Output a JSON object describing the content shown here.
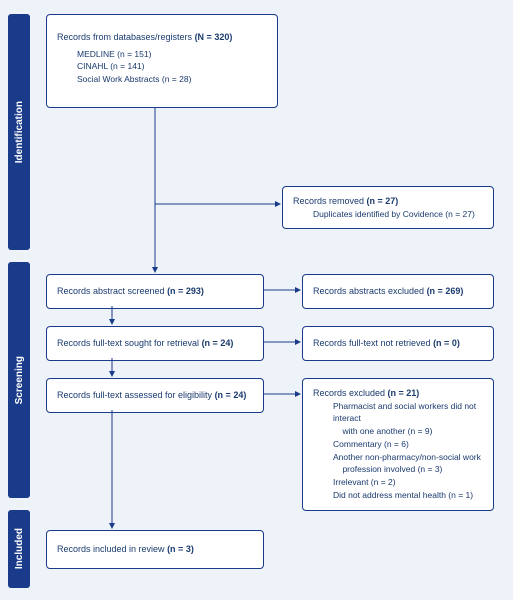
{
  "stages": {
    "identification": "Identification",
    "screening": "Screening",
    "included": "Included"
  },
  "boxes": {
    "sources": {
      "title_pre": "Records from databases/registers ",
      "title_n": "(N = 320)",
      "items": [
        "MEDLINE (n = 151)",
        "CINAHL (n = 141)",
        "Social Work Abstracts (n = 28)"
      ]
    },
    "removed": {
      "title_pre": "Records removed ",
      "title_n": "(n = 27)",
      "items": [
        "Duplicates identified by Covidence (n = 27)"
      ]
    },
    "abs_screened": {
      "text_pre": "Records abstract screened ",
      "n": "(n = 293)"
    },
    "abs_excluded": {
      "text_pre": "Records abstracts excluded ",
      "n": "(n = 269)"
    },
    "ft_sought": {
      "text_pre": "Records full-text sought for retrieval ",
      "n": "(n = 24)"
    },
    "ft_notret": {
      "text_pre": "Records full-text not retrieved ",
      "n": "(n = 0)"
    },
    "ft_assessed": {
      "text_pre": "Records full-text assessed for eligibility ",
      "n": "(n = 24)"
    },
    "excluded": {
      "title_pre": "Records excluded ",
      "title_n": "(n = 21)",
      "items": [
        "Pharmacist and social workers did not interact",
        "    with one another (n = 9)",
        "Commentary (n = 6)",
        "Another non-pharmacy/non-social work",
        "    profession involved (n = 3)",
        "Irrelevant (n = 2)",
        "Did not address mental health (n = 1)"
      ]
    },
    "included": {
      "text_pre": "Records included in review ",
      "n": "(n = 3)"
    }
  },
  "chart_data": {
    "type": "diagram",
    "description": "PRISMA-style flow diagram of study identification, screening and inclusion",
    "counts": {
      "records_identified_total": 320,
      "by_source": {
        "MEDLINE": 151,
        "CINAHL": 141,
        "Social Work Abstracts": 28
      },
      "records_removed_before_screening": 27,
      "duplicates_covidence": 27,
      "abstracts_screened": 293,
      "abstracts_excluded": 269,
      "fulltext_sought": 24,
      "fulltext_not_retrieved": 0,
      "fulltext_assessed": 24,
      "fulltext_excluded_total": 21,
      "excluded_reasons": {
        "pharmacist_and_social_workers_did_not_interact": 9,
        "commentary": 6,
        "another_non_pharmacy_non_social_work_profession_involved": 3,
        "irrelevant": 2,
        "did_not_address_mental_health": 1
      },
      "included_in_review": 3
    }
  }
}
